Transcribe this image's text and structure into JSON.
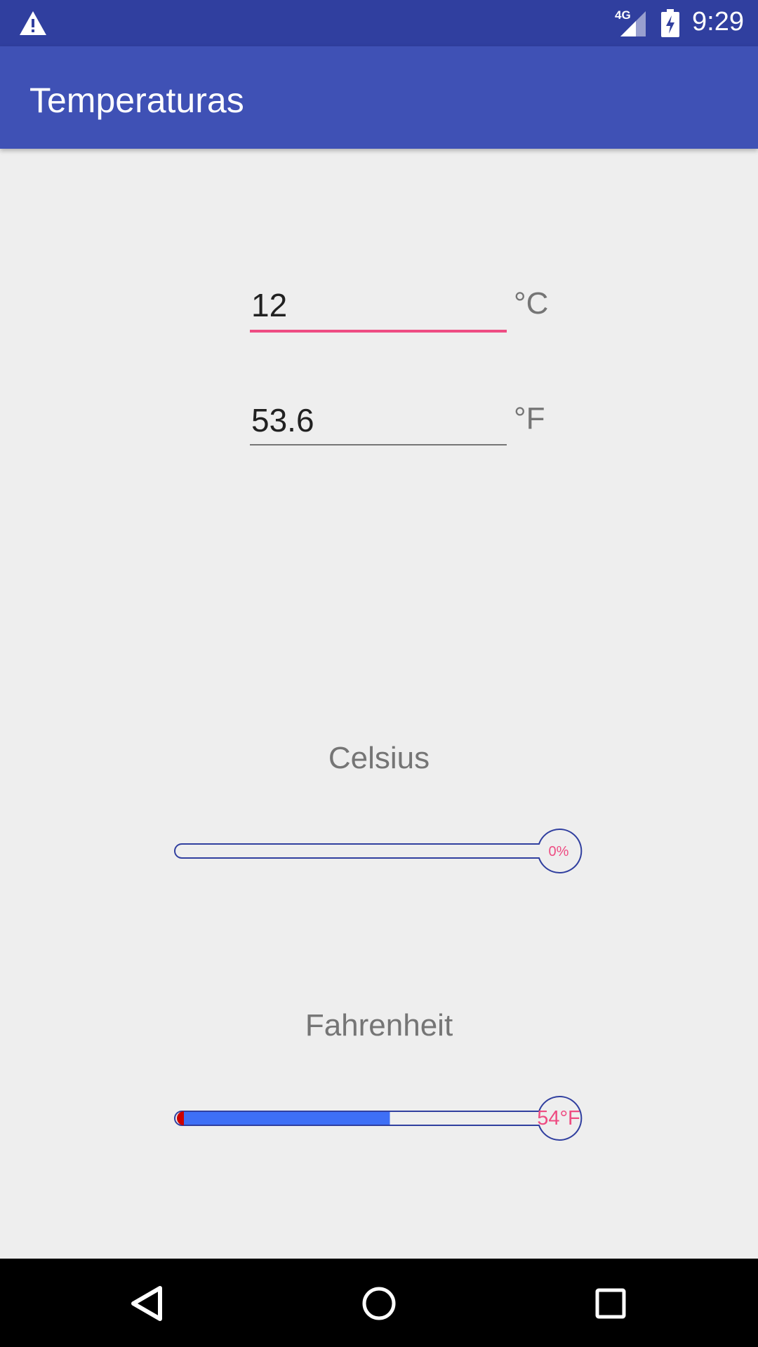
{
  "status_bar": {
    "time": "9:29",
    "network": "4G",
    "icons": [
      "warning-icon",
      "signal-icon",
      "battery-charging-icon"
    ],
    "background": "#303f9f"
  },
  "app_bar": {
    "title": "Temperaturas",
    "background": "#3f51b5"
  },
  "celsius_input": {
    "value": "12",
    "unit": "°C",
    "focused": true,
    "accent": "#ee4c82"
  },
  "fahrenheit_input": {
    "value": "53.6",
    "unit": "°F",
    "focused": false
  },
  "celsius_gauge": {
    "label": "Celsius",
    "readout": "0%",
    "fill_fraction": 0
  },
  "fahrenheit_gauge": {
    "label": "Fahrenheit",
    "readout": "54°F",
    "fill_fraction": 0.58,
    "fill_color": "#3e6ff6",
    "bulb_color": "#cc0000"
  },
  "nav_bar": {
    "icons": [
      "back-icon",
      "home-icon",
      "recents-icon"
    ]
  }
}
